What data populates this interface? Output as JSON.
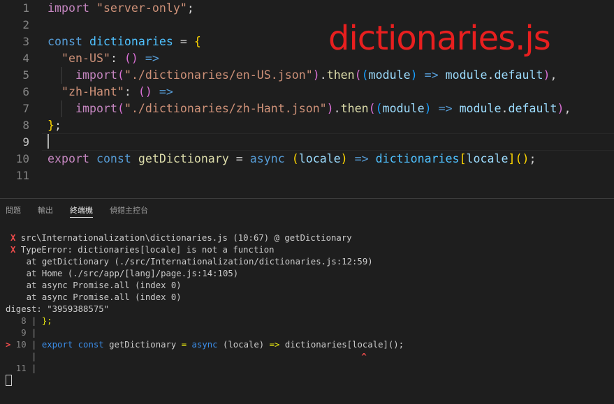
{
  "editor": {
    "filename_overlay": "dictionaries.js",
    "line_numbers": [
      "1",
      "2",
      "3",
      "4",
      "5",
      "6",
      "7",
      "8",
      "9",
      "10",
      "11"
    ],
    "line1": {
      "import": "import",
      "module": "\"server-only\"",
      "semi": ";"
    },
    "line3": {
      "const": "const",
      "name": "dictionaries",
      "eq": " = ",
      "brace": "{"
    },
    "line4": {
      "key": "\"en-US\"",
      "colon": ": ",
      "parens": "()",
      "arrow": " =>"
    },
    "line5": {
      "import": "import",
      "open": "(",
      "path": "\"./dictionaries/en-US.json\"",
      "close": ")",
      "dot": ".",
      "then": "then",
      "open2": "(",
      "open3": "(",
      "param": "module",
      "close3": ")",
      "arrow": " => ",
      "obj": "module",
      "dot2": ".",
      "prop": "default",
      "close2": ")",
      "comma": ","
    },
    "line6": {
      "key": "\"zh-Hant\"",
      "colon": ": ",
      "parens": "()",
      "arrow": " =>"
    },
    "line7": {
      "import": "import",
      "open": "(",
      "path": "\"./dictionaries/zh-Hant.json\"",
      "close": ")",
      "dot": ".",
      "then": "then",
      "open2": "(",
      "open3": "(",
      "param": "module",
      "close3": ")",
      "arrow": " => ",
      "obj": "module",
      "dot2": ".",
      "prop": "default",
      "close2": ")",
      "comma": ","
    },
    "line8": {
      "brace": "}",
      "semi": ";"
    },
    "line10": {
      "export": "export",
      "const": "const",
      "fn": "getDictionary",
      "eq": " = ",
      "async": "async",
      "open": "(",
      "param": "locale",
      "close": ")",
      "arrow": " => ",
      "obj": "dictionaries",
      "bopen": "[",
      "key": "locale",
      "bclose": "]",
      "call": "()",
      "semi": ";"
    }
  },
  "panel": {
    "tabs": [
      "問題",
      "輸出",
      "終端機",
      "偵錯主控台"
    ],
    "active_tab": "終端機",
    "terminal": {
      "x": "X",
      "err_location": " src\\Internationalization\\dictionaries.js (10:67) @ getDictionary",
      "err_type": " TypeError: dictionaries[locale] is not a function",
      "stack1": "    at getDictionary (./src/Internationalization/dictionaries.js:12:59)",
      "stack2": "    at Home (./src/app/[lang]/page.js:14:105)",
      "stack3": "    at async Promise.all (index 0)",
      "stack4": "    at async Promise.all (index 0)",
      "digest": "digest: \"3959388575\"",
      "c8_num": "   8 | ",
      "c8_code": "};",
      "c9": "   9 |",
      "c10_marker": ">",
      "c10_num": " 10 | ",
      "c10_export": "export",
      "c10_const": " const",
      "c10_fn": " getDictionary ",
      "c10_eq": "= ",
      "c10_async": "async",
      "c10_rest": " (locale) ",
      "c10_arrow": "=>",
      "c10_tail": " dictionaries[locale]();",
      "caret_pipe": "     |",
      "caret": "^",
      "c11": "  11 |"
    }
  }
}
